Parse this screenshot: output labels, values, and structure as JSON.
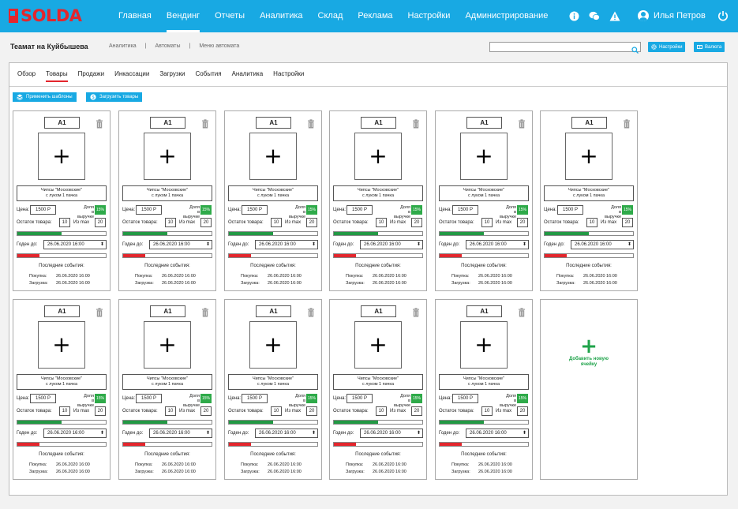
{
  "brand": {
    "part1": "SOL",
    "part2": "DA"
  },
  "nav": [
    "Главная",
    "Вендинг",
    "Отчеты",
    "Аналитика",
    "Склад",
    "Реклама",
    "Настройки",
    "Администрирование"
  ],
  "nav_active": 1,
  "user": {
    "name": "Илья Петров"
  },
  "subheader": {
    "venue": "Теамат на Куйбышева",
    "breadcrumbs": [
      "Аналитика",
      "Автоматы",
      "Меню автомата"
    ],
    "search_placeholder": "",
    "settings_btn": "Настройки",
    "currency_btn": "Валюта"
  },
  "tabs": [
    "Обзор",
    "Товары",
    "Продажи",
    "Инкассации",
    "Загрузки",
    "События",
    "Аналитика",
    "Настройки"
  ],
  "tabs_active": 1,
  "actions": {
    "apply_templates": "Применить шаблоны",
    "load_goods": "Загрузить товары"
  },
  "card": {
    "slot": "A1",
    "product_line1": "Чипсы \"Московские\"",
    "product_line2": "с луком 1 пачка",
    "price_label": "Цена:",
    "price": "1500 Р",
    "share_label_1": "Доля",
    "share_label_2": "в выручке",
    "share": "15%",
    "stock_label": "Остаток товара:",
    "stock": "10",
    "max_label": "Из max",
    "max": "20",
    "stock_level": 0.5,
    "expiry_label": "Годен до:",
    "expiry": "26.06.2020 16:00",
    "expiry_level": 0.25,
    "events_title": "Последние события:",
    "purchase_label": "Покупка:",
    "purchase": "26.06.2020 16:00",
    "load_label": "Загрузка:",
    "load": "26.06.2020 16:00"
  },
  "add_cell_label": "Добавить новую ячейку",
  "icons": [
    "info-icon",
    "chat-icon",
    "alert-icon",
    "user-icon",
    "power-icon",
    "search-icon",
    "gear-icon",
    "currency-icon",
    "layers-icon",
    "trash-icon",
    "plus-icon"
  ],
  "colors": {
    "primary": "#18a9e3",
    "brand_red": "#e3262d",
    "green": "#229944"
  }
}
